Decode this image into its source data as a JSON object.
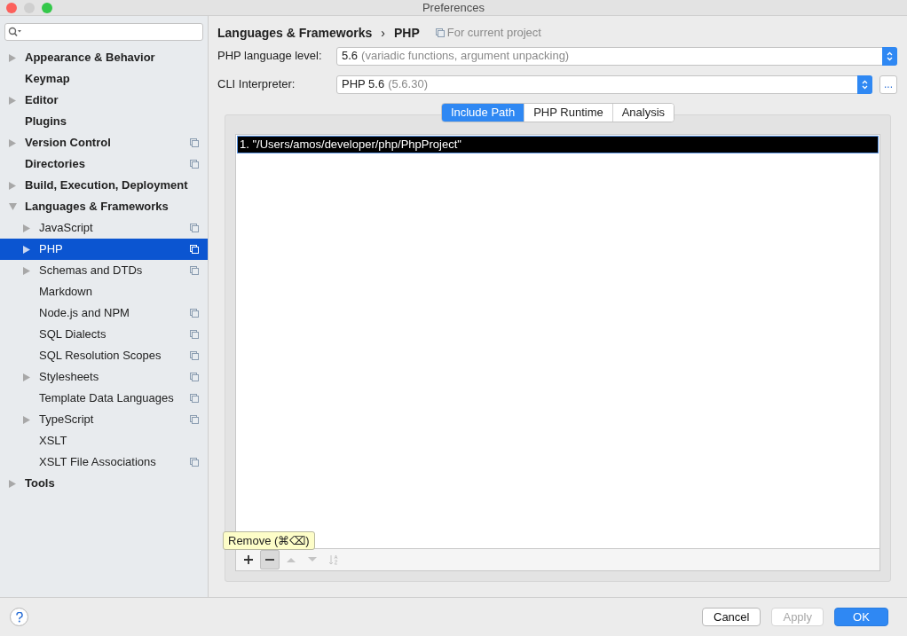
{
  "window": {
    "title": "Preferences"
  },
  "sidebar": {
    "items": [
      {
        "label": "Appearance & Behavior",
        "kind": "folder",
        "expanded": false,
        "selected": false,
        "per_project": false
      },
      {
        "label": "Keymap",
        "kind": "page",
        "selected": false,
        "per_project": false
      },
      {
        "label": "Editor",
        "kind": "folder",
        "expanded": false,
        "selected": false,
        "per_project": false
      },
      {
        "label": "Plugins",
        "kind": "page",
        "selected": false,
        "per_project": false
      },
      {
        "label": "Version Control",
        "kind": "folder",
        "expanded": false,
        "selected": false,
        "per_project": true
      },
      {
        "label": "Directories",
        "kind": "page",
        "selected": false,
        "per_project": true
      },
      {
        "label": "Build, Execution, Deployment",
        "kind": "folder",
        "expanded": false,
        "selected": false,
        "per_project": false
      },
      {
        "label": "Languages & Frameworks",
        "kind": "folder",
        "expanded": true,
        "selected": false,
        "per_project": false,
        "children": [
          {
            "label": "JavaScript",
            "kind": "folder",
            "expanded": false,
            "selected": false,
            "per_project": true
          },
          {
            "label": "PHP",
            "kind": "folder",
            "expanded": false,
            "selected": true,
            "per_project": true
          },
          {
            "label": "Schemas and DTDs",
            "kind": "folder",
            "expanded": false,
            "selected": false,
            "per_project": true
          },
          {
            "label": "Markdown",
            "kind": "page",
            "selected": false,
            "per_project": false
          },
          {
            "label": "Node.js and NPM",
            "kind": "page",
            "selected": false,
            "per_project": true
          },
          {
            "label": "SQL Dialects",
            "kind": "page",
            "selected": false,
            "per_project": true
          },
          {
            "label": "SQL Resolution Scopes",
            "kind": "page",
            "selected": false,
            "per_project": true
          },
          {
            "label": "Stylesheets",
            "kind": "folder",
            "expanded": false,
            "selected": false,
            "per_project": true
          },
          {
            "label": "Template Data Languages",
            "kind": "page",
            "selected": false,
            "per_project": true
          },
          {
            "label": "TypeScript",
            "kind": "folder",
            "expanded": false,
            "selected": false,
            "per_project": true
          },
          {
            "label": "XSLT",
            "kind": "page",
            "selected": false,
            "per_project": false
          },
          {
            "label": "XSLT File Associations",
            "kind": "page",
            "selected": false,
            "per_project": true
          }
        ]
      },
      {
        "label": "Tools",
        "kind": "folder",
        "expanded": false,
        "selected": false,
        "per_project": false
      }
    ]
  },
  "breadcrumb": {
    "parent": "Languages & Frameworks",
    "separator": "›",
    "current": "PHP",
    "scope": "For current project"
  },
  "fields": [
    {
      "label": "PHP language level:",
      "value": "5.6",
      "detail": "(variadic functions, argument unpacking)",
      "browse": false
    },
    {
      "label": "CLI Interpreter:",
      "value": "PHP 5.6",
      "detail": "(5.6.30)",
      "browse": true,
      "browse_label": "..."
    }
  ],
  "tabs": [
    {
      "label": "Include Path",
      "selected": true
    },
    {
      "label": "PHP Runtime",
      "selected": false
    },
    {
      "label": "Analysis",
      "selected": false
    }
  ],
  "include_paths": [
    {
      "text": "1. \"/Users/amos/developer/php/PhpProject\"",
      "selected": true
    }
  ],
  "toolbar": [
    {
      "kind": "add",
      "disabled": false,
      "hovered": false
    },
    {
      "kind": "remove",
      "disabled": false,
      "hovered": true
    },
    {
      "kind": "up",
      "disabled": true,
      "hovered": false
    },
    {
      "kind": "down",
      "disabled": true,
      "hovered": false
    },
    {
      "kind": "sort",
      "disabled": true,
      "hovered": false
    }
  ],
  "tooltip": "Remove (⌘⌫)",
  "buttons": [
    {
      "label": "Cancel",
      "kind": "normal",
      "disabled": false
    },
    {
      "label": "Apply",
      "kind": "normal",
      "disabled": true
    },
    {
      "label": "OK",
      "kind": "default",
      "disabled": false
    }
  ]
}
